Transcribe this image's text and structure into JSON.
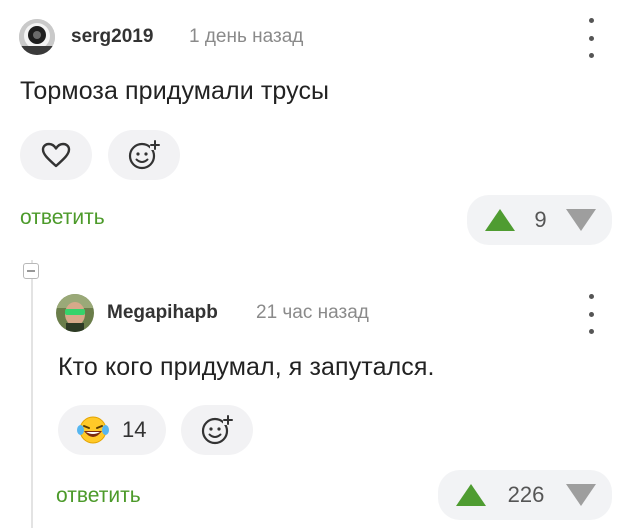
{
  "comments": [
    {
      "username": "serg2019",
      "time": "1 день назад",
      "text": "Тормоза придумали трусы",
      "reply_label": "ответить",
      "rating": "9"
    },
    {
      "username": "Megapihapb",
      "time": "21 час назад",
      "text": "Кто кого придумал, я запутался.",
      "reply_label": "ответить",
      "reaction_count": "14",
      "rating": "226"
    }
  ],
  "colors": {
    "reply": "#4c9a2a",
    "upvote": "#4f9c31",
    "downvote": "#9e9e9e",
    "pill_bg": "#f2f2f4"
  },
  "icons": [
    "avatar",
    "more-vertical-icon",
    "heart-icon",
    "add-emoji-icon",
    "laughing-emoji-icon",
    "upvote-icon",
    "downvote-icon",
    "collapse-icon"
  ]
}
